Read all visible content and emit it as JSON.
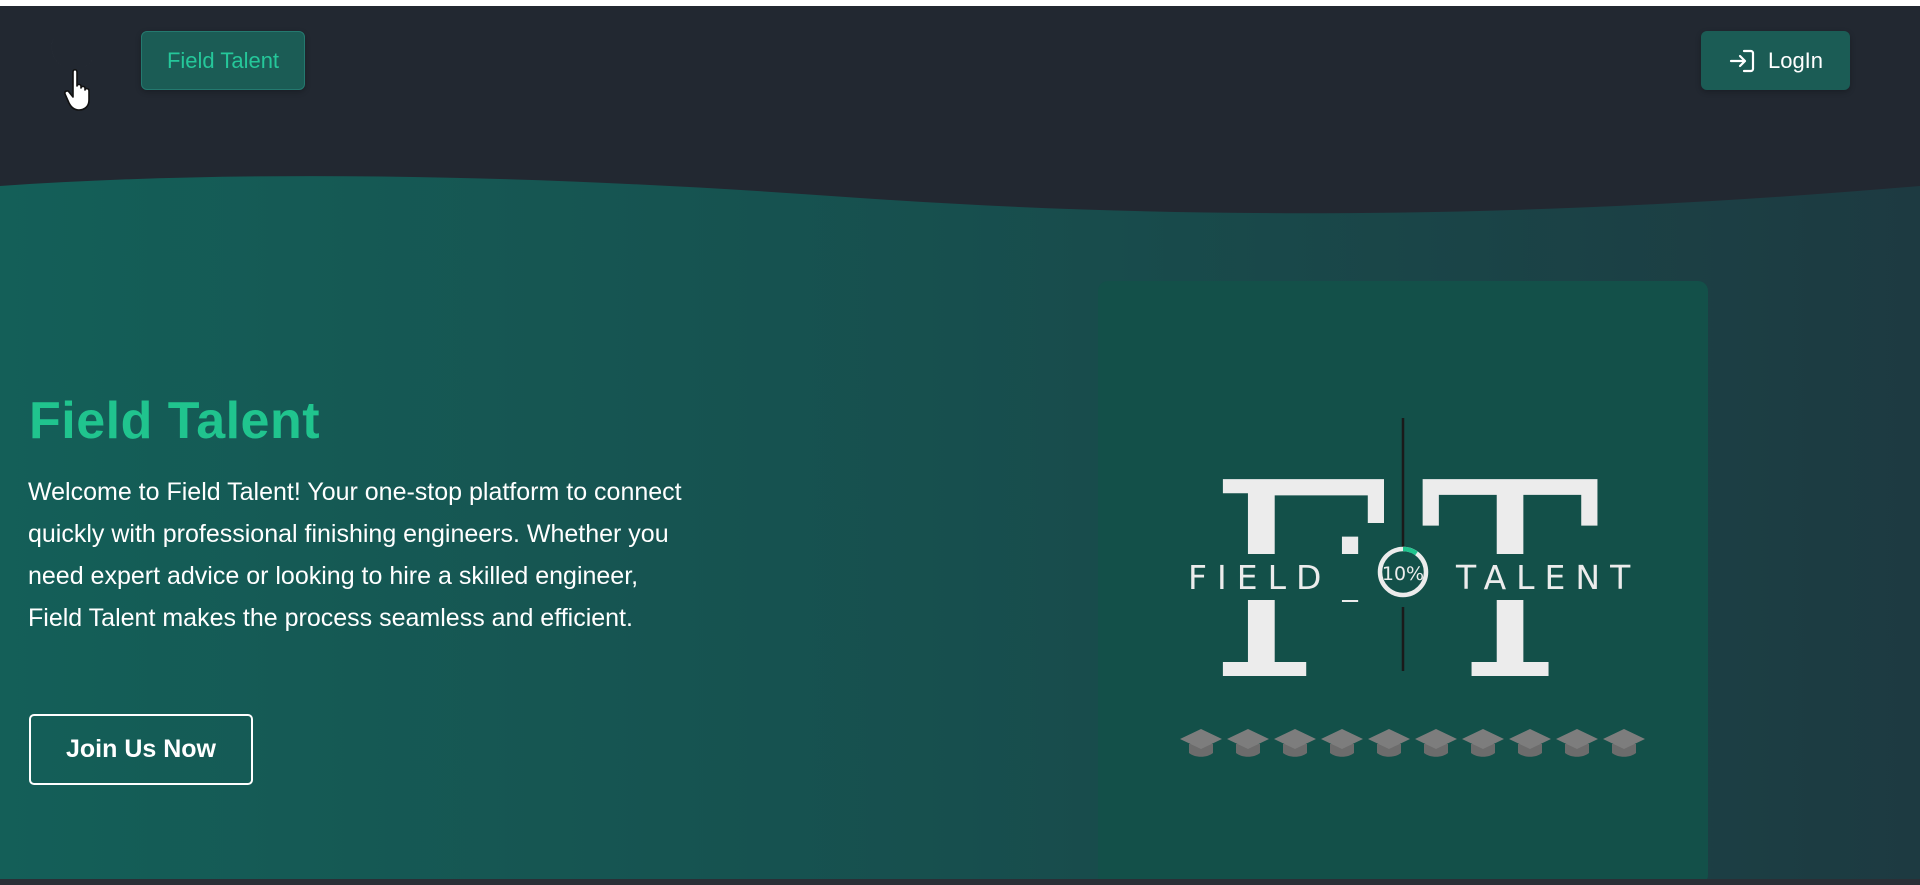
{
  "header": {
    "logo_icon": "crescent-moon-icon",
    "brand_button": "Field Talent",
    "login_button": "LogIn",
    "login_icon": "login-arrow-icon"
  },
  "hero": {
    "title": "Field Talent",
    "description": "Welcome to Field Talent! Your one-stop platform to connect quickly with professional finishing engineers. Whether you need expert advice or looking to hire a skilled engineer, Field Talent makes the process seamless and efficient.",
    "cta_button": "Join Us Now"
  },
  "logo_card": {
    "left_word": "FIELD",
    "right_word": "TALENT",
    "progress_text": "10%",
    "progress_value": 0.1,
    "cap_icon": "graduation-cap-icon",
    "cap_count": 10
  },
  "colors": {
    "background": "#222831",
    "teal": "#135049",
    "accent_green": "#20c48e",
    "button_bg": "#1b5c55"
  }
}
